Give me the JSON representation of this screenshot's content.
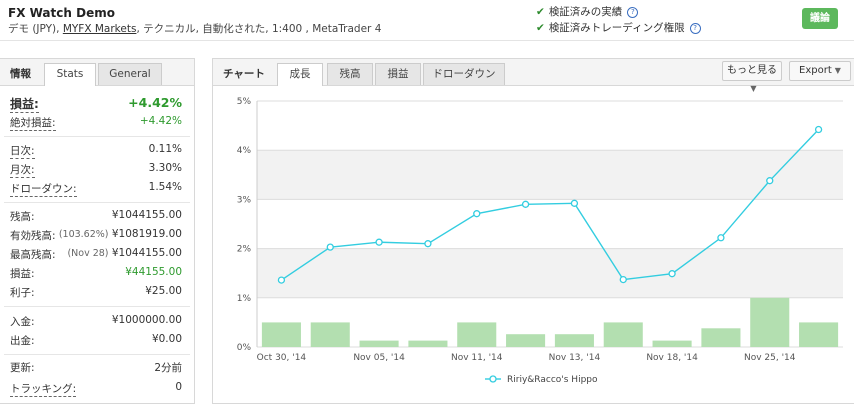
{
  "account": {
    "name": "FX Watch   Demo",
    "sub_prefix": "デモ (JPY), ",
    "broker": "MYFX Markets",
    "sub_suffix": ", テクニカル, 自動化された, 1:400 , MetaTrader 4"
  },
  "verification": {
    "line1": "検証済みの実績",
    "line2": "検証済みトレーディング権限",
    "check_icon": "checkmark-icon",
    "help_icon": "question-icon",
    "check_color": "#2e8b2e"
  },
  "discuss_button": "議論",
  "left_panel": {
    "title": "情報",
    "tabs": [
      "Stats",
      "General"
    ],
    "active_tab": "Stats",
    "gain_label": "損益:",
    "gain_value": "+4.42%",
    "abs_gain_label": "絶対損益:",
    "abs_gain_value": "+4.42%",
    "daily_label": "日次:",
    "daily_value": "0.11%",
    "monthly_label": "月次:",
    "monthly_value": "3.30%",
    "drawdown_label": "ドローダウン:",
    "drawdown_value": "1.54%",
    "balance_label": "残高:",
    "balance_value": "¥1044155.00",
    "equity_label": "有効残高:",
    "equity_note": "(103.62%)",
    "equity_value": "¥1081919.00",
    "highest_label": "最高残高:",
    "highest_note": "(Nov 28)",
    "highest_value": "¥1044155.00",
    "profit_label": "損益:",
    "profit_value": "¥44155.00",
    "interest_label": "利子:",
    "interest_value": "¥25.00",
    "deposits_label": "入金:",
    "deposits_value": "¥1000000.00",
    "withdrawals_label": "出金:",
    "withdrawals_value": "¥0.00",
    "updated_label": "更新:",
    "updated_value": "2分前",
    "tracking_label": "トラッキング:",
    "tracking_value": "0",
    "accent_green": "#2e9a2e"
  },
  "right_panel": {
    "title": "チャート",
    "tabs": [
      "成長",
      "残高",
      "損益",
      "ドローダウン"
    ],
    "active_tab": "成長",
    "more_button": "もっと見る",
    "export_button": "Export"
  },
  "chart_data": {
    "type": "bar",
    "ylim": [
      0,
      5
    ],
    "y_ticks": [
      "0%",
      "1%",
      "2%",
      "3%",
      "4%",
      "5%"
    ],
    "x_tick_labels": [
      "Oct 30, '14",
      "Nov 05, '14",
      "Nov 11, '14",
      "Nov 13, '14",
      "Nov 18, '14",
      "Nov 25, '14"
    ],
    "bar_color": "#b3dfb0",
    "bars": [
      0.5,
      0.5,
      0.13,
      0.13,
      0.5,
      0.26,
      0.26,
      0.5,
      0.13,
      0.38,
      1.0,
      0.5
    ],
    "line_color": "#33cde0",
    "series": [
      {
        "name": "Ririy&Racco's Hippo",
        "values": [
          1.36,
          2.03,
          2.13,
          2.1,
          2.71,
          2.9,
          2.92,
          1.37,
          1.49,
          2.22,
          3.38,
          4.42
        ]
      }
    ],
    "grid": true
  }
}
